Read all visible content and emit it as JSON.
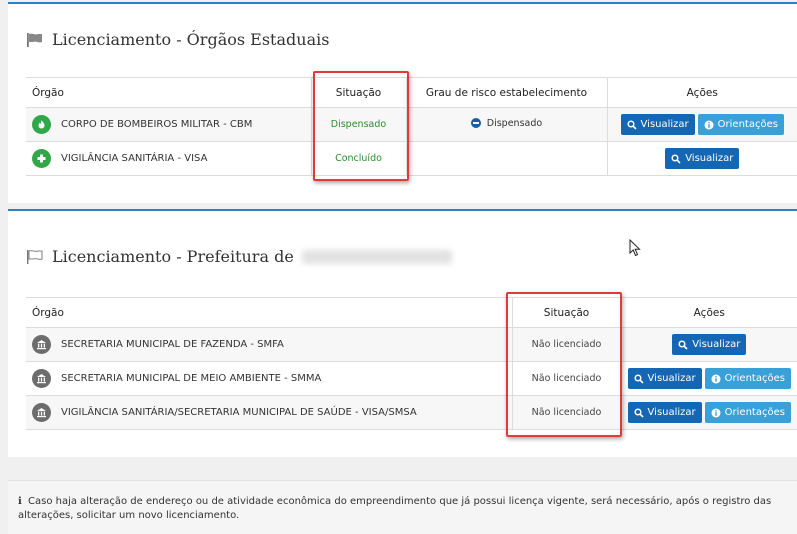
{
  "estaduais": {
    "title": "Licenciamento - Órgãos Estaduais",
    "headers": {
      "orgao": "Órgão",
      "situacao": "Situação",
      "grau": "Grau de risco estabelecimento",
      "acoes": "Ações"
    },
    "rows": [
      {
        "orgao": "CORPO DE BOMBEIROS MILITAR - CBM",
        "situacao": "Dispensado",
        "grau": "Dispensado",
        "btn_visualizar": "Visualizar",
        "btn_orientacoes": "Orientações"
      },
      {
        "orgao": "VIGILÂNCIA SANITÁRIA - VISA",
        "situacao": "Concluído",
        "grau": "",
        "btn_visualizar": "Visualizar"
      }
    ]
  },
  "prefeitura": {
    "title": "Licenciamento - Prefeitura de",
    "headers": {
      "orgao": "Órgão",
      "situacao": "Situação",
      "acoes": "Ações"
    },
    "rows": [
      {
        "orgao": "SECRETARIA MUNICIPAL DE FAZENDA - SMFA",
        "situacao": "Não licenciado",
        "btn_visualizar": "Visualizar"
      },
      {
        "orgao": "SECRETARIA MUNICIPAL DE MEIO AMBIENTE - SMMA",
        "situacao": "Não licenciado",
        "btn_visualizar": "Visualizar",
        "btn_orientacoes": "Orientações"
      },
      {
        "orgao": "VIGILÂNCIA SANITÁRIA/SECRETARIA MUNICIPAL DE SAÚDE - VISA/SMSA",
        "situacao": "Não licenciado",
        "btn_visualizar": "Visualizar",
        "btn_orientacoes": "Orientações"
      }
    ]
  },
  "notice": {
    "icon": "ℹ",
    "text": "Caso haja alteração de endereço ou de atividade econômica do empreendimento que já possui licença vigente, será necessário, após o registro das alterações, solicitar um novo licenciamento."
  },
  "colors": {
    "panel_border": "#2f7ec7",
    "button_primary": "#1566b3",
    "button_info": "#3aa0d8",
    "status_green": "#2f8c2f",
    "highlight_box": "#e03a3a"
  }
}
